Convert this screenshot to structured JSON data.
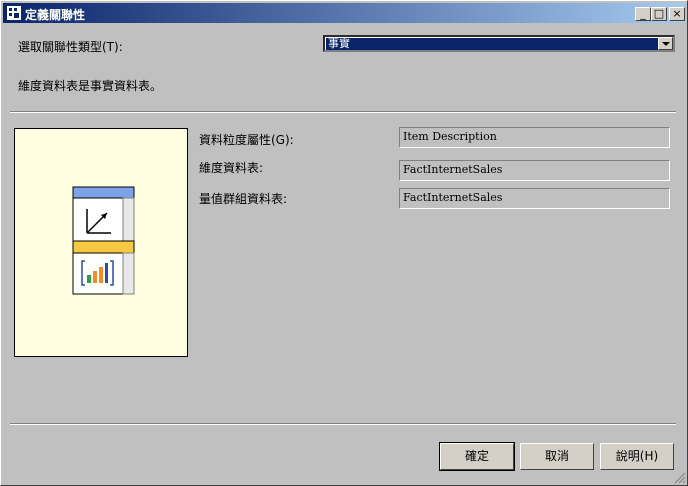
{
  "window": {
    "title": "定義關聯性"
  },
  "titlebar_buttons": {
    "minimize": "_",
    "maximize": "□",
    "close": "×"
  },
  "relationship_type": {
    "label": "選取關聯性類型(T):",
    "selected": "事實"
  },
  "description": "維度資料表是事實資料表。",
  "fields": [
    {
      "label": "資料粒度屬性(G):",
      "value": "Item Description"
    },
    {
      "label": "維度資料表:",
      "value": "FactInternetSales"
    },
    {
      "label": "量值群組資料表:",
      "value": "FactInternetSales"
    }
  ],
  "buttons": {
    "ok": "確定",
    "cancel": "取消",
    "help": "說明(H)"
  },
  "colors": {
    "title_start": "#0a246a",
    "title_end": "#a6caf0",
    "preview_bg": "#fffee0",
    "selection": "#0a246a"
  }
}
